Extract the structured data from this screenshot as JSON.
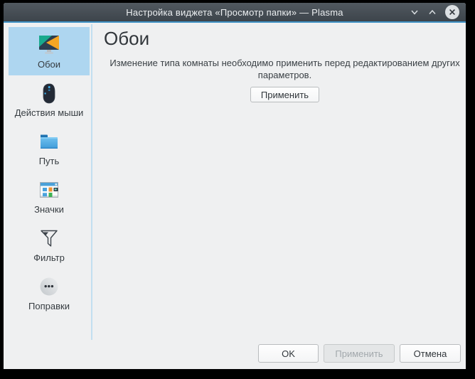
{
  "window": {
    "title": "Настройка виджета «Просмотр папки» — Plasma",
    "controls": {
      "minimize": "chevron-down-icon",
      "maximize": "chevron-up-icon",
      "close": "close-circle-icon"
    }
  },
  "sidebar": {
    "items": [
      {
        "label": "Обои",
        "icon": "wallpaper-icon",
        "selected": true
      },
      {
        "label": "Действия мыши",
        "icon": "mouse-icon",
        "selected": false
      },
      {
        "label": "Путь",
        "icon": "folder-icon",
        "selected": false
      },
      {
        "label": "Значки",
        "icon": "icons-view-icon",
        "selected": false
      },
      {
        "label": "Фильтр",
        "icon": "filter-funnel-icon",
        "selected": false
      },
      {
        "label": "Поправки",
        "icon": "tweaks-dots-icon",
        "selected": false
      }
    ]
  },
  "content": {
    "heading": "Обои",
    "message": "Изменение типа комнаты необходимо применить перед редактированием других параметров.",
    "apply_button": "Применить"
  },
  "footer": {
    "ok": "OK",
    "apply": "Применить",
    "apply_enabled": false,
    "cancel": "Отмена"
  },
  "colors": {
    "titlebar": "#454d54",
    "titlebar_underline": "#3f91c4",
    "window_background": "#eff0f1",
    "selection_highlight": "#aed6f0",
    "accent_blue": "#3daee9"
  }
}
